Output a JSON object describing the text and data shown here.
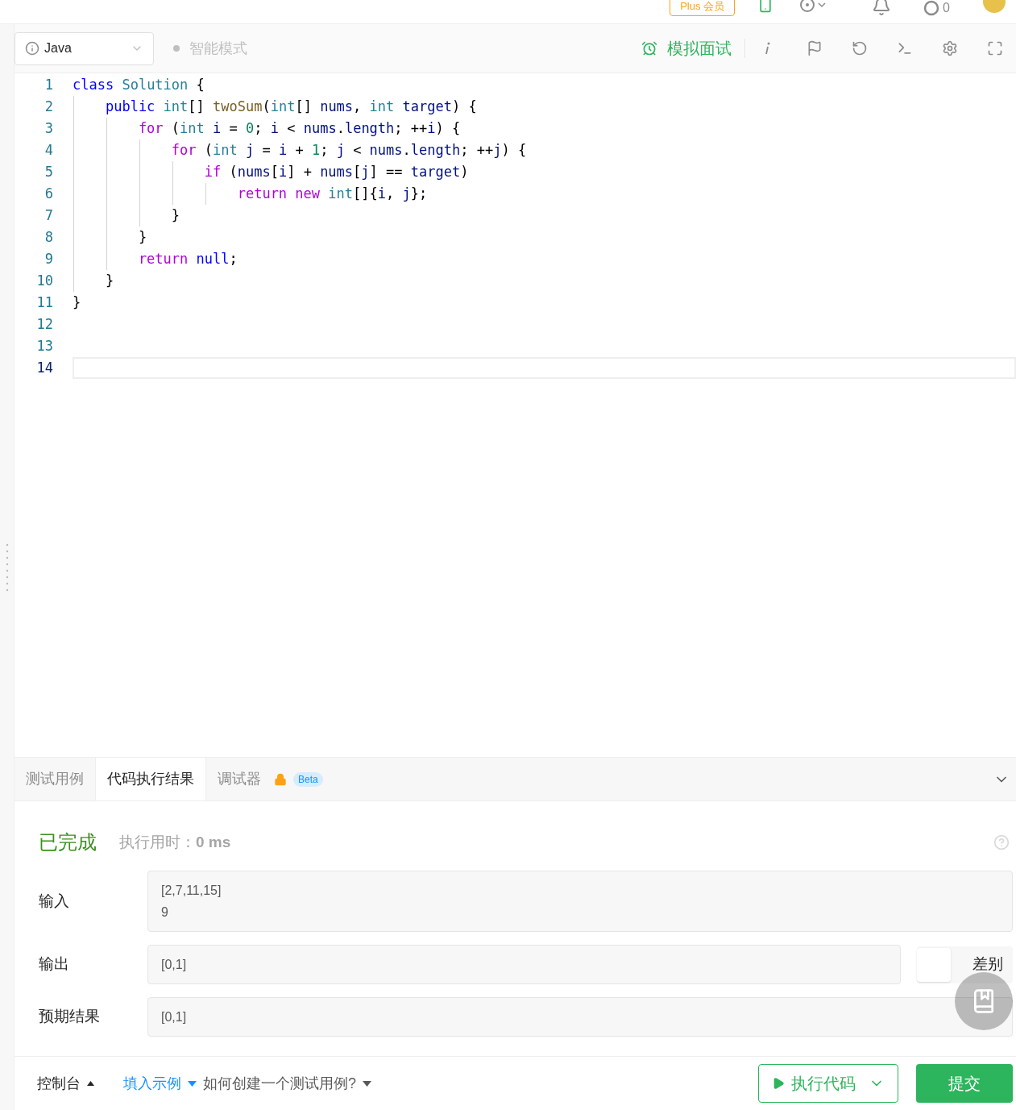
{
  "header": {
    "plus_button": "Plus 会员",
    "counter": "0"
  },
  "toolbar": {
    "language": "Java",
    "mode": "智能模式",
    "interview_button": "模拟面试"
  },
  "editor": {
    "lines": [
      {
        "number": "1",
        "current": false,
        "tokens": [
          {
            "text": "class",
            "kind": "storage"
          },
          {
            "text": " Solution",
            "kind": "type"
          },
          {
            "text": " {",
            "kind": "plain"
          }
        ]
      },
      {
        "number": "2",
        "current": false,
        "tokens": [
          {
            "text": "    public",
            "kind": "storage"
          },
          {
            "text": " int",
            "kind": "type"
          },
          {
            "text": "[] ",
            "kind": "plain"
          },
          {
            "text": "twoSum",
            "kind": "function"
          },
          {
            "text": "(",
            "kind": "plain"
          },
          {
            "text": "int",
            "kind": "type"
          },
          {
            "text": "[] ",
            "kind": "plain"
          },
          {
            "text": "nums",
            "kind": "variable"
          },
          {
            "text": ", ",
            "kind": "plain"
          },
          {
            "text": "int",
            "kind": "type"
          },
          {
            "text": " target",
            "kind": "variable"
          },
          {
            "text": ") {",
            "kind": "plain"
          }
        ]
      },
      {
        "number": "3",
        "current": false,
        "tokens": [
          {
            "text": "        for",
            "kind": "keyword"
          },
          {
            "text": " (",
            "kind": "plain"
          },
          {
            "text": "int",
            "kind": "type"
          },
          {
            "text": " i",
            "kind": "variable"
          },
          {
            "text": " = ",
            "kind": "plain"
          },
          {
            "text": "0",
            "kind": "number"
          },
          {
            "text": "; ",
            "kind": "plain"
          },
          {
            "text": "i",
            "kind": "variable"
          },
          {
            "text": " < ",
            "kind": "plain"
          },
          {
            "text": "nums",
            "kind": "variable"
          },
          {
            "text": ".",
            "kind": "plain"
          },
          {
            "text": "length",
            "kind": "variable"
          },
          {
            "text": "; ++",
            "kind": "plain"
          },
          {
            "text": "i",
            "kind": "variable"
          },
          {
            "text": ") {",
            "kind": "plain"
          }
        ]
      },
      {
        "number": "4",
        "current": false,
        "tokens": [
          {
            "text": "            for",
            "kind": "keyword"
          },
          {
            "text": " (",
            "kind": "plain"
          },
          {
            "text": "int",
            "kind": "type"
          },
          {
            "text": " j",
            "kind": "variable"
          },
          {
            "text": " = ",
            "kind": "plain"
          },
          {
            "text": "i",
            "kind": "variable"
          },
          {
            "text": " + ",
            "kind": "plain"
          },
          {
            "text": "1",
            "kind": "number"
          },
          {
            "text": "; ",
            "kind": "plain"
          },
          {
            "text": "j",
            "kind": "variable"
          },
          {
            "text": " < ",
            "kind": "plain"
          },
          {
            "text": "nums",
            "kind": "variable"
          },
          {
            "text": ".",
            "kind": "plain"
          },
          {
            "text": "length",
            "kind": "variable"
          },
          {
            "text": "; ++",
            "kind": "plain"
          },
          {
            "text": "j",
            "kind": "variable"
          },
          {
            "text": ") {",
            "kind": "plain"
          }
        ]
      },
      {
        "number": "5",
        "current": false,
        "tokens": [
          {
            "text": "                if",
            "kind": "keyword"
          },
          {
            "text": " (",
            "kind": "plain"
          },
          {
            "text": "nums",
            "kind": "variable"
          },
          {
            "text": "[",
            "kind": "plain"
          },
          {
            "text": "i",
            "kind": "variable"
          },
          {
            "text": "] + ",
            "kind": "plain"
          },
          {
            "text": "nums",
            "kind": "variable"
          },
          {
            "text": "[",
            "kind": "plain"
          },
          {
            "text": "j",
            "kind": "variable"
          },
          {
            "text": "] == ",
            "kind": "plain"
          },
          {
            "text": "target",
            "kind": "variable"
          },
          {
            "text": ")",
            "kind": "plain"
          }
        ]
      },
      {
        "number": "6",
        "current": false,
        "tokens": [
          {
            "text": "                    return",
            "kind": "keyword"
          },
          {
            "text": " new",
            "kind": "keyword"
          },
          {
            "text": " int",
            "kind": "type"
          },
          {
            "text": "[]{",
            "kind": "plain"
          },
          {
            "text": "i",
            "kind": "variable"
          },
          {
            "text": ", ",
            "kind": "plain"
          },
          {
            "text": "j",
            "kind": "variable"
          },
          {
            "text": "};",
            "kind": "plain"
          }
        ]
      },
      {
        "number": "7",
        "current": false,
        "tokens": [
          {
            "text": "            }",
            "kind": "plain"
          }
        ]
      },
      {
        "number": "8",
        "current": false,
        "tokens": [
          {
            "text": "        }",
            "kind": "plain"
          }
        ]
      },
      {
        "number": "9",
        "current": false,
        "tokens": [
          {
            "text": "        return",
            "kind": "keyword"
          },
          {
            "text": " null",
            "kind": "storage"
          },
          {
            "text": ";",
            "kind": "plain"
          }
        ]
      },
      {
        "number": "10",
        "current": false,
        "tokens": [
          {
            "text": "    }",
            "kind": "plain"
          }
        ]
      },
      {
        "number": "11",
        "current": false,
        "tokens": [
          {
            "text": "}",
            "kind": "plain"
          }
        ]
      },
      {
        "number": "12",
        "current": false
      },
      {
        "number": "13",
        "current": false
      },
      {
        "number": "14",
        "current": true
      }
    ]
  },
  "panel": {
    "tabs": [
      {
        "label": "测试用例",
        "selected": false
      },
      {
        "label": "代码执行结果",
        "selected": true
      },
      {
        "label": "调试器",
        "selected": false,
        "badge": "Beta"
      }
    ],
    "status": "已完成",
    "runtime_label": "执行用时：",
    "runtime_value": "0 ms",
    "fields": [
      {
        "label": "输入",
        "lines": [
          "[2,7,11,15]",
          "9"
        ]
      },
      {
        "label": "输出",
        "lines": [
          "[0,1]"
        ],
        "diff_label": "差别"
      },
      {
        "label": "预期结果",
        "lines": [
          "[0,1]"
        ]
      }
    ]
  },
  "footer": {
    "console": "控制台",
    "fill_example": "填入示例",
    "how_to": "如何创建一个测试用例?",
    "run_button": "执行代码",
    "submit_button": "提交"
  }
}
